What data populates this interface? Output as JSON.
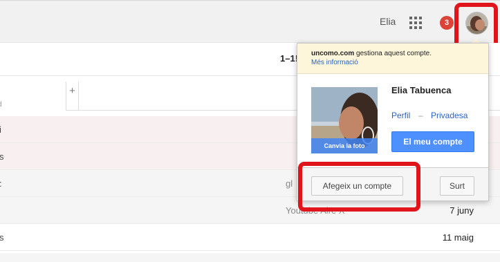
{
  "topbar": {
    "username": "Elia",
    "notification_count": "3"
  },
  "toolbar": {
    "pager": "1–1!"
  },
  "tabs": {
    "left_fragment": "d",
    "add_tab_label": "+"
  },
  "rows": [
    {
      "frag": "i",
      "snip": "",
      "date": ""
    },
    {
      "frag": "s",
      "snip": "",
      "date": ""
    },
    {
      "frag": ":",
      "snip": "gl",
      "date": ""
    },
    {
      "frag": "",
      "snip": "Youtube Aire X",
      "date": "7 juny"
    },
    {
      "frag": "s",
      "snip": "",
      "date": "11 maig"
    }
  ],
  "account_popup": {
    "manager_domain": "uncomo.com",
    "manager_text": " gestiona aquest compte.",
    "more_info": "Més informació",
    "full_name": "Elia Tabuenca",
    "profile_link": "Perfil",
    "separator": "–",
    "privacy_link": "Privadesa",
    "my_account_button": "El meu compte",
    "change_photo": "Canvia la foto",
    "add_account_button": "Afegeix un compte",
    "sign_out_button": "Surt"
  },
  "colors": {
    "highlight_box": "#e0151c",
    "primary_button": "#4d90fe",
    "notification_badge": "#db4437",
    "popup_header": "#fdf6da"
  }
}
